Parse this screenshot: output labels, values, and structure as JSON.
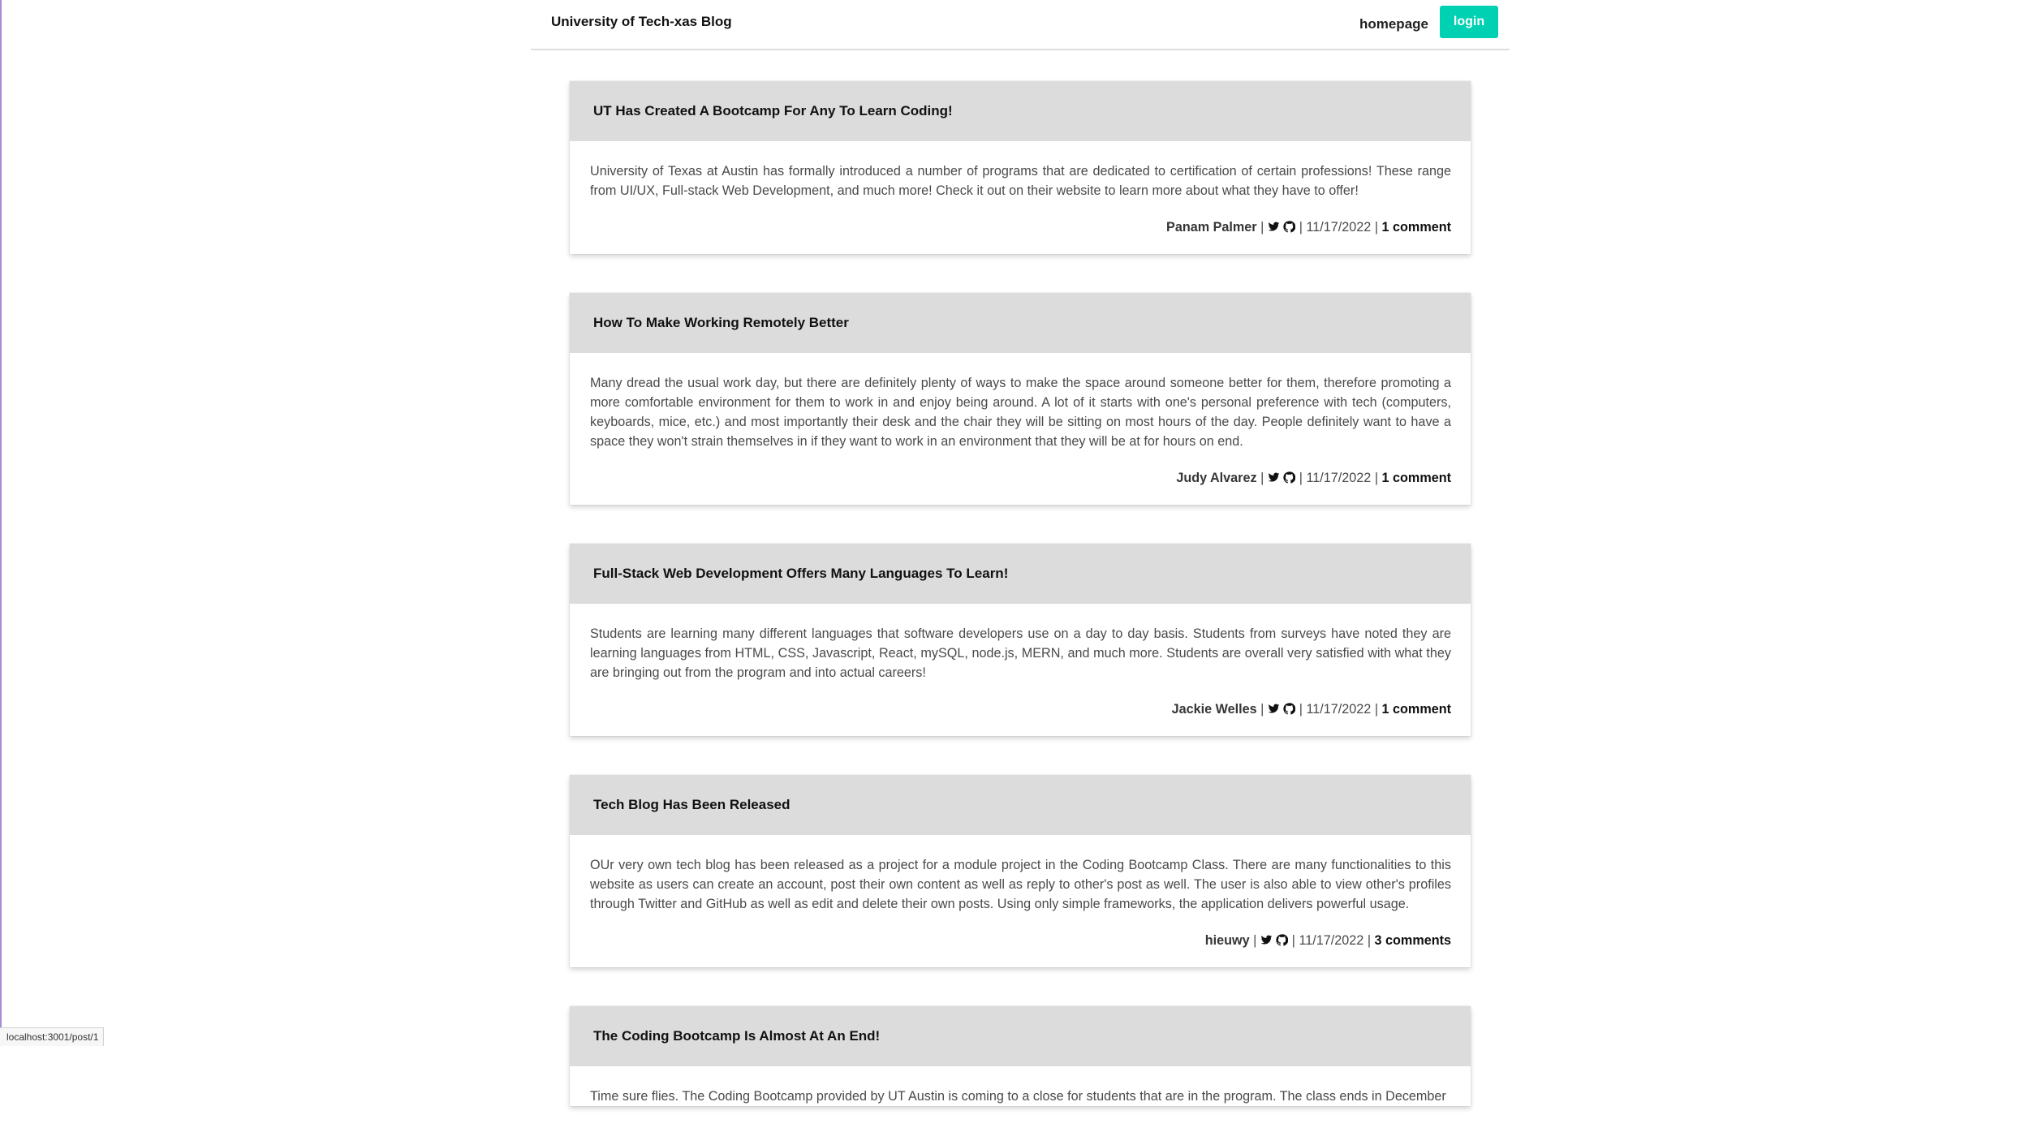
{
  "header": {
    "brand": "University of Tech-xas Blog",
    "homepage_label": "homepage",
    "login_label": "login",
    "login_color": "#00d1b2"
  },
  "posts": [
    {
      "title": "UT Has Created A Bootcamp For Any To Learn Coding!",
      "body": "University of Texas at Austin has formally introduced a number of programs that are dedicated to certification of certain professions! These range from UI/UX, Full-stack Web Development, and much more! Check it out on their website to learn more about what they have to offer!",
      "author": "Panam Palmer",
      "date": "11/17/2022",
      "comments": "1 comment"
    },
    {
      "title": "How To Make Working Remotely Better",
      "body": "Many dread the usual work day, but there are definitely plenty of ways to make the space around someone better for them, therefore promoting a more comfortable environment for them to work in and enjoy being around. A lot of it starts with one's personal preference with tech (computers, keyboards, mice, etc.) and most importantly their desk and the chair they will be sitting on most hours of the day. People definitely want to have a space they won't strain themselves in if they want to work in an environment that they will be at for hours on end.",
      "author": "Judy Alvarez",
      "date": "11/17/2022",
      "comments": "1 comment"
    },
    {
      "title": "Full-Stack Web Development Offers Many Languages To Learn!",
      "body": "Students are learning many different languages that software developers use on a day to day basis. Students from surveys have noted they are learning languages from HTML, CSS, Javascript, React, mySQL, node.js, MERN, and much more. Students are overall very satisfied with what they are bringing out from the program and into actual careers!",
      "author": "Jackie Welles",
      "date": "11/17/2022",
      "comments": "1 comment"
    },
    {
      "title": "Tech Blog Has Been Released",
      "body": "OUr very own tech blog has been released as a project for a module project in the Coding Bootcamp Class. There are many functionalities to this website as users can create an account, post their own content as well as reply to other's post as well. The user is also able to view other's profiles through Twitter and GitHub as well as edit and delete their own posts. Using only simple frameworks, the application delivers powerful usage.",
      "author": "hieuwy",
      "date": "11/17/2022",
      "comments": "3 comments"
    },
    {
      "title": "The Coding Bootcamp Is Almost At An End!",
      "body": "Time sure flies. The Coding Bootcamp provided by UT Austin is coming to a close for students that are in the program. The class ends in December",
      "author": "",
      "date": "",
      "comments": ""
    }
  ],
  "icons": {
    "twitter": "twitter-icon",
    "github": "github-icon"
  },
  "status_bar": {
    "url": "localhost:3001/post/1"
  }
}
